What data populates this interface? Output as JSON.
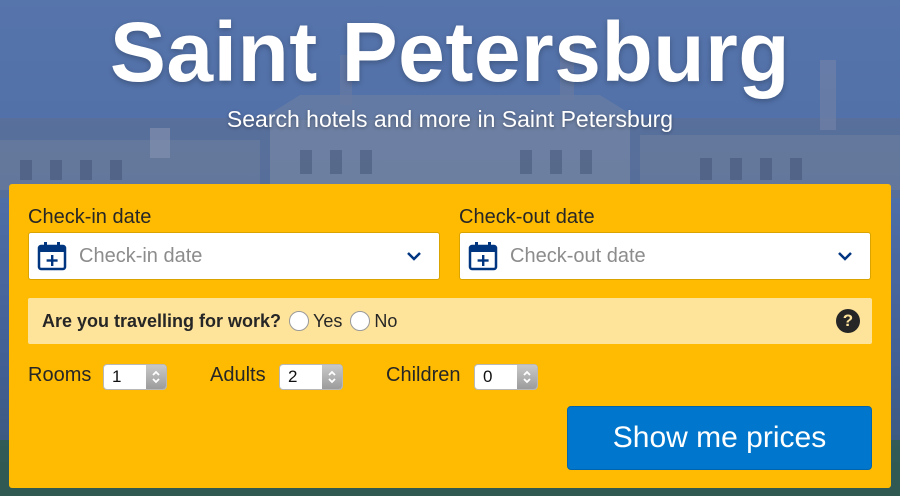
{
  "hero": {
    "title": "Saint Petersburg",
    "subtitle": "Search hotels and more in Saint Petersburg"
  },
  "search": {
    "checkin": {
      "label": "Check-in date",
      "placeholder": "Check-in date",
      "icon": "calendar-plus-icon"
    },
    "checkout": {
      "label": "Check-out date",
      "placeholder": "Check-out date",
      "icon": "calendar-plus-icon"
    },
    "work": {
      "question": "Are you travelling for work?",
      "options": [
        "Yes",
        "No"
      ],
      "help_glyph": "?"
    },
    "occupancy": {
      "rooms": {
        "label": "Rooms",
        "value": "1"
      },
      "adults": {
        "label": "Adults",
        "value": "2"
      },
      "children": {
        "label": "Children",
        "value": "0"
      }
    },
    "submit_label": "Show me prices"
  },
  "colors": {
    "panel": "#febb02",
    "work_row": "#fee39a",
    "button": "#0077cc",
    "calendar_icon": "#003580"
  }
}
